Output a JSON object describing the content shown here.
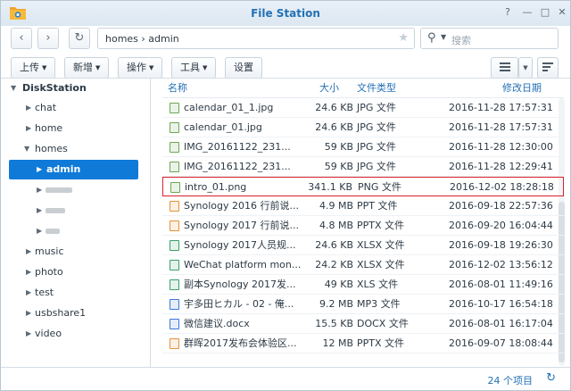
{
  "window": {
    "title": "File Station",
    "help": "?",
    "minimize": "—",
    "maximize": "□",
    "close": "✕"
  },
  "nav": {
    "back": "‹",
    "forward": "›",
    "refresh": "↻",
    "path": "homes  ›  admin",
    "favorite": "★",
    "search_placeholder": "搜索"
  },
  "toolbar": {
    "upload": "上传",
    "new": "新增",
    "action": "操作",
    "tools": "工具",
    "settings": "设置"
  },
  "sidebar": {
    "root": "DiskStation",
    "items": [
      {
        "label": "chat"
      },
      {
        "label": "home"
      },
      {
        "label": "homes"
      },
      {
        "label": "admin"
      },
      {
        "label": ""
      },
      {
        "label": ""
      },
      {
        "label": ""
      },
      {
        "label": "music"
      },
      {
        "label": "photo"
      },
      {
        "label": "test"
      },
      {
        "label": "usbshare1"
      },
      {
        "label": "video"
      }
    ]
  },
  "columns": {
    "name": "名称",
    "size": "大小",
    "type": "文件类型",
    "modified": "修改日期"
  },
  "files": [
    {
      "name": "calendar_01_1.jpg",
      "size": "24.6 KB",
      "type": "JPG 文件",
      "modified": "2016-11-28 17:57:31",
      "icon": "image-icon",
      "color": "#6aa84f"
    },
    {
      "name": "calendar_01.jpg",
      "size": "24.6 KB",
      "type": "JPG 文件",
      "modified": "2016-11-28 17:57:31",
      "icon": "image-icon",
      "color": "#6aa84f"
    },
    {
      "name": "IMG_20161122_231...",
      "size": "59 KB",
      "type": "JPG 文件",
      "modified": "2016-11-28 12:30:00",
      "icon": "image-icon",
      "color": "#6aa84f"
    },
    {
      "name": "IMG_20161122_231...",
      "size": "59 KB",
      "type": "JPG 文件",
      "modified": "2016-11-28 12:29:41",
      "icon": "image-icon",
      "color": "#6aa84f"
    },
    {
      "name": "intro_01.png",
      "size": "341.1 KB",
      "type": "PNG 文件",
      "modified": "2016-12-02 18:28:18",
      "icon": "image-icon",
      "color": "#6aa84f"
    },
    {
      "name": "Synology 2016 行前说...",
      "size": "4.9 MB",
      "type": "PPT 文件",
      "modified": "2016-09-18 22:57:36",
      "icon": "ppt-icon",
      "color": "#e69138"
    },
    {
      "name": "Synology 2017 行前说...",
      "size": "4.8 MB",
      "type": "PPTX 文件",
      "modified": "2016-09-20 16:04:44",
      "icon": "ppt-icon",
      "color": "#e69138"
    },
    {
      "name": "Synology 2017人员规...",
      "size": "24.6 KB",
      "type": "XLSX 文件",
      "modified": "2016-09-18 19:26:30",
      "icon": "spreadsheet-icon",
      "color": "#38a169"
    },
    {
      "name": "WeChat platform mon...",
      "size": "24.2 KB",
      "type": "XLSX 文件",
      "modified": "2016-12-02 13:56:12",
      "icon": "spreadsheet-icon",
      "color": "#38a169"
    },
    {
      "name": "副本Synology 2017发...",
      "size": "49 KB",
      "type": "XLS 文件",
      "modified": "2016-08-01 11:49:16",
      "icon": "spreadsheet-icon",
      "color": "#38a169"
    },
    {
      "name": "宇多田ヒカル - 02 - 俺...",
      "size": "9.2 MB",
      "type": "MP3 文件",
      "modified": "2016-10-17 16:54:18",
      "icon": "music-icon",
      "color": "#3c78d8"
    },
    {
      "name": "微信建议.docx",
      "size": "15.5 KB",
      "type": "DOCX 文件",
      "modified": "2016-08-01 16:17:04",
      "icon": "doc-icon",
      "color": "#3c78d8"
    },
    {
      "name": "群晖2017发布会体验区...",
      "size": "12 MB",
      "type": "PPTX 文件",
      "modified": "2016-09-07 18:08:44",
      "icon": "ppt-icon",
      "color": "#e69138"
    }
  ],
  "status": {
    "count": "24 个项目",
    "refresh": "↻"
  },
  "colors": {
    "accent": "#2471b5",
    "selected": "#0f7ad8",
    "highlight_border": "#d9232d"
  }
}
